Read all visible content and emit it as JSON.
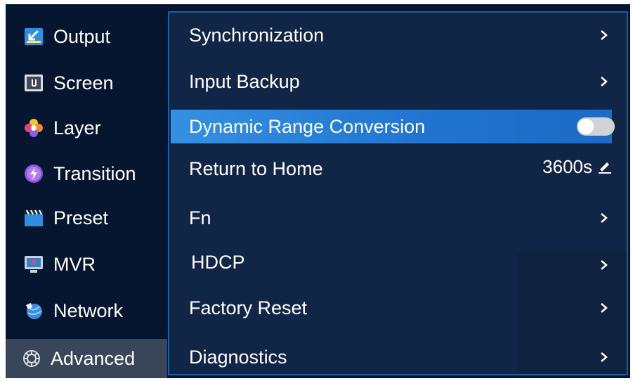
{
  "sidebar": {
    "items": [
      {
        "label": "Output",
        "icon": "output-icon"
      },
      {
        "label": "Screen",
        "icon": "screen-icon"
      },
      {
        "label": "Layer",
        "icon": "layer-icon"
      },
      {
        "label": "Transition",
        "icon": "transition-icon"
      },
      {
        "label": "Preset",
        "icon": "preset-icon"
      },
      {
        "label": "MVR",
        "icon": "mvr-icon"
      },
      {
        "label": "Network",
        "icon": "network-icon"
      },
      {
        "label": "Advanced",
        "icon": "gear-icon",
        "active": true
      }
    ]
  },
  "menu": {
    "items": [
      {
        "label": "Synchronization",
        "control": "chevron"
      },
      {
        "label": "Input Backup",
        "control": "chevron"
      },
      {
        "label": "Dynamic Range Conversion",
        "control": "toggle",
        "toggle_on": false,
        "selected": true
      },
      {
        "label": "Return to Home",
        "control": "value",
        "value": "3600s"
      },
      {
        "label": "Fn",
        "control": "chevron"
      },
      {
        "label": "HDCP",
        "control": "chevron"
      },
      {
        "label": "Factory Reset",
        "control": "chevron"
      },
      {
        "label": "Diagnostics",
        "control": "chevron"
      }
    ]
  },
  "colors": {
    "background": "#071630",
    "panel": "#112647",
    "panel_border": "#1c5ea6",
    "selected_row": "#2a80d8",
    "active_sidebar": "#39465a"
  }
}
